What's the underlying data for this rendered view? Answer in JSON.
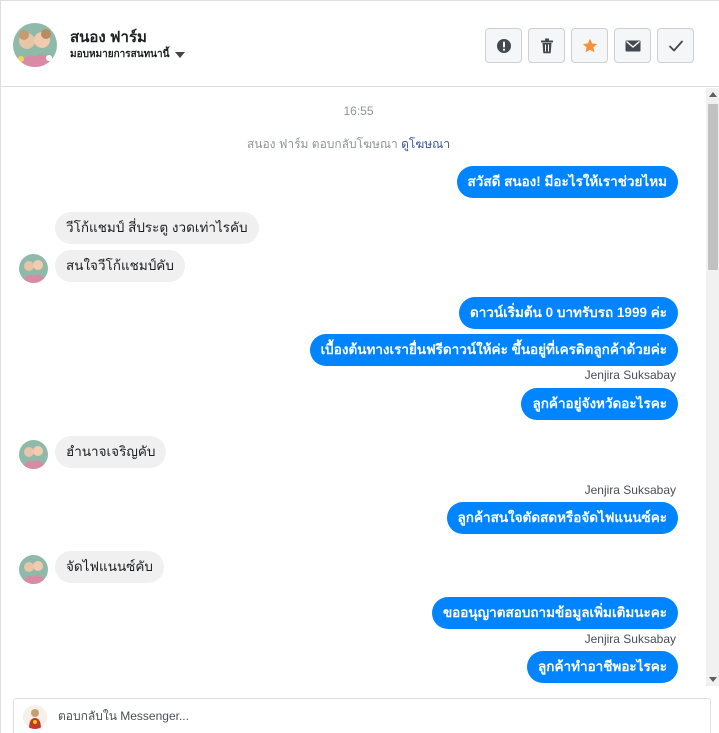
{
  "header": {
    "page_name": "สนอง ฟาร์ม",
    "assign_label": "มอบหมายการสนทนานี้",
    "actions": [
      {
        "icon": "alert-icon",
        "color": "#444950"
      },
      {
        "icon": "trash-icon",
        "color": "#444950"
      },
      {
        "icon": "star-icon",
        "color": "#f7923b"
      },
      {
        "icon": "envelope-icon",
        "color": "#444950"
      },
      {
        "icon": "check-icon",
        "color": "#444950"
      }
    ]
  },
  "conversation": {
    "timestamp": "16:55",
    "ad_reply_text": "สนอง ฟาร์ม ตอบกลับโฆษณา",
    "ad_link": "ดูโฆษณา",
    "messages": [
      {
        "direction": "out",
        "text": "สวัสดี สนอง! มีอะไรให้เราช่วยไหม"
      },
      {
        "direction": "in",
        "text": "วีโก้แชมป์ สี่ประตู งวดเท่าไรคับ"
      },
      {
        "direction": "in",
        "text": "สนใจวีโก้แชมป์คับ"
      },
      {
        "direction": "out",
        "text": "ดาวน์เริ่มต้น 0 บาทรับรถ 1999 ค่ะ"
      },
      {
        "direction": "out",
        "text": "เบื้องต้นทางเรายื่นฟรีดาวน์ให้ค่ะ ขึ้นอยู่ที่เครดิตลูกค้าด้วยค่ะ"
      },
      {
        "direction": "out",
        "sender": "Jenjira Suksabay",
        "text": "ลูกค้าอยู่จังหวัดอะไรคะ"
      },
      {
        "direction": "in",
        "text": "ฮำนาจเจริญคับ"
      },
      {
        "direction": "out",
        "sender": "Jenjira Suksabay",
        "text": "ลูกค้าสนใจตัดสดหรือจัดไฟแนนซ์คะ"
      },
      {
        "direction": "in",
        "text": "จัดไฟแนนซ์คับ"
      },
      {
        "direction": "out",
        "text": "ขออนุญาตสอบถามข้อมูลเพิ่มเติมนะคะ"
      },
      {
        "direction": "out",
        "sender": "Jenjira Suksabay",
        "text": "ลูกค้าทำอาชีพอะไรคะ"
      }
    ]
  },
  "reply": {
    "placeholder": "ตอบกลับใน Messenger..."
  },
  "colors": {
    "outgoing_bubble": "#0084ff",
    "incoming_bubble": "#f1f0f0",
    "link": "#385898",
    "star": "#f7923b"
  }
}
